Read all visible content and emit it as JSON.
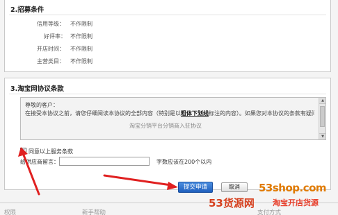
{
  "requirements": {
    "title": "2.招募条件",
    "conditions": [
      {
        "label": "信用等级：",
        "value": "不作限制"
      },
      {
        "label": "好评率：",
        "value": "不作限制"
      },
      {
        "label": "开店时间：",
        "value": "不作限制"
      },
      {
        "label": "主营类目：",
        "value": "不作限制"
      }
    ]
  },
  "protocol": {
    "title": "3.淘宝网协议条款",
    "greeting": "尊敬的客户：",
    "body_pre": "在接受本协议之前，请您仔细阅读本协议的全部内容（特别是以",
    "body_bold": "粗体下划线",
    "body_post": "标注的内容）。如果您对本协议的条款有疑问的",
    "body_faded": "淘宝分销平台分销商入驻协议"
  },
  "form": {
    "agree_checked": true,
    "agree_label": "同意以上服务条款",
    "message_label": "给供应商留言：",
    "message_value": "",
    "message_hint": "字数应该在200个以内",
    "submit_label": "提交申请",
    "cancel_label": "取消"
  },
  "footer": {
    "tabs": [
      "权限",
      "新手帮助",
      "支付方式"
    ]
  },
  "watermark": {
    "url": "53shop.com",
    "brand": "53货源网",
    "slogan": "淘宝开店货源"
  },
  "colors": {
    "annotation_arrow": "#e02020",
    "submit_button": "#2a6ccc",
    "watermark_orange": "#e07a00",
    "watermark_red": "#d6401e"
  }
}
